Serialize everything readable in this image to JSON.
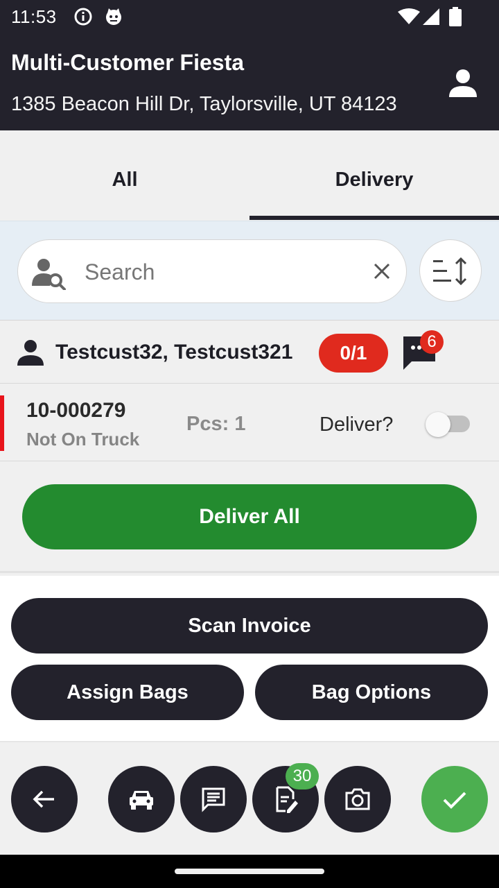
{
  "status_bar": {
    "time": "11:53",
    "icons": [
      "info-icon",
      "cat-notification-icon",
      "wifi-icon",
      "signal-icon",
      "battery-icon"
    ]
  },
  "header": {
    "title": "Multi-Customer Fiesta",
    "address": "1385 Beacon Hill Dr, Taylorsville, UT 84123",
    "profile_icon": "person-icon"
  },
  "tabs": [
    {
      "label": "All",
      "selected": false
    },
    {
      "label": "Delivery",
      "selected": true
    }
  ],
  "search": {
    "placeholder": "Search",
    "value": "",
    "icons": [
      "user-search-icon",
      "clear-icon",
      "sort-icon"
    ]
  },
  "customer": {
    "name": "Testcust32, Testcust321",
    "progress_badge": "0/1",
    "messages_count": "6",
    "icons": [
      "person-icon",
      "chat-icon"
    ]
  },
  "invoice": {
    "number": "10-000279",
    "status": "Not On Truck",
    "pieces": "Pcs: 1",
    "deliver_label": "Deliver?",
    "deliver_toggle_on": false
  },
  "deliver_all_label": "Deliver All",
  "actions": {
    "scan_invoice": "Scan Invoice",
    "assign_bags": "Assign Bags",
    "bag_options": "Bag Options"
  },
  "bottom_bar": {
    "buttons": [
      "back-arrow-icon",
      "car-icon",
      "message-icon",
      "notes-icon",
      "camera-icon",
      "check-icon"
    ],
    "notes_badge": "30"
  },
  "colors": {
    "dark": "#23222c",
    "green": "#238b2f",
    "light_green": "#4caf50",
    "red": "#e02a1e",
    "alert_bar": "#e8141b"
  }
}
